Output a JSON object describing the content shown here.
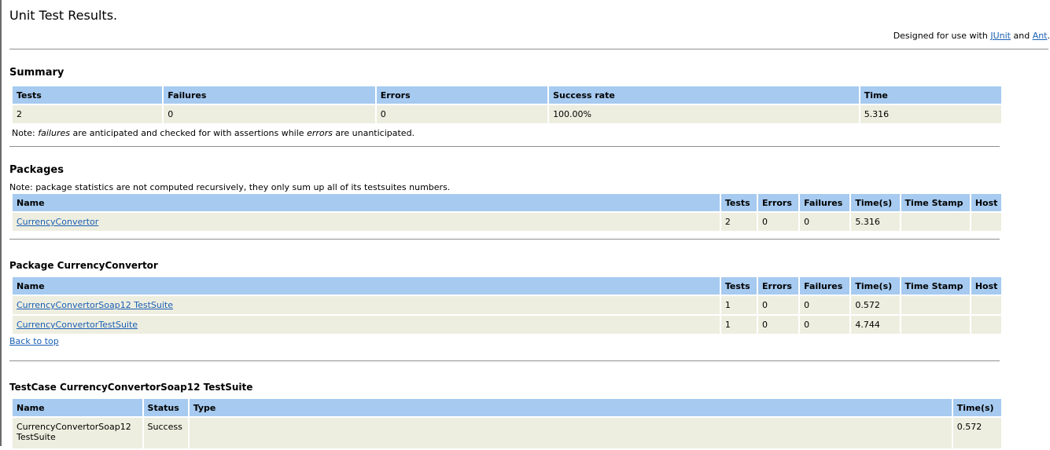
{
  "page": {
    "title": "Unit Test Results.",
    "designed_prefix": "Designed for use with ",
    "designed_link1": "JUnit",
    "designed_and": " and ",
    "designed_link2": "Ant",
    "designed_suffix": "."
  },
  "summary": {
    "heading": "Summary",
    "headers": [
      "Tests",
      "Failures",
      "Errors",
      "Success rate",
      "Time"
    ],
    "row": [
      "2",
      "0",
      "0",
      "100.00%",
      "5.316"
    ],
    "note_prefix": "Note: ",
    "note_em1": "failures",
    "note_mid": " are anticipated and checked for with assertions while ",
    "note_em2": "errors",
    "note_suffix": " are unanticipated."
  },
  "packages": {
    "heading": "Packages",
    "note": "Note: package statistics are not computed recursively, they only sum up all of its testsuites numbers.",
    "headers": [
      "Name",
      "Tests",
      "Errors",
      "Failures",
      "Time(s)",
      "Time Stamp",
      "Host"
    ],
    "row": {
      "name": "CurrencyConvertor",
      "tests": "2",
      "errors": "0",
      "failures": "0",
      "time": "5.316",
      "timestamp": "",
      "host": ""
    }
  },
  "package_detail": {
    "heading": "Package CurrencyConvertor",
    "headers": [
      "Name",
      "Tests",
      "Errors",
      "Failures",
      "Time(s)",
      "Time Stamp",
      "Host"
    ],
    "rows": [
      {
        "name": "CurrencyConvertorSoap12 TestSuite",
        "tests": "1",
        "errors": "0",
        "failures": "0",
        "time": "0.572",
        "timestamp": "",
        "host": ""
      },
      {
        "name": "CurrencyConvertorTestSuite",
        "tests": "1",
        "errors": "0",
        "failures": "0",
        "time": "4.744",
        "timestamp": "",
        "host": ""
      }
    ],
    "back_to_top": "Back to top"
  },
  "testcase": {
    "heading": "TestCase CurrencyConvertorSoap12 TestSuite",
    "headers": [
      "Name",
      "Status",
      "Type",
      "Time(s)"
    ],
    "row": {
      "name_line1": "CurrencyConvertorSoap12",
      "name_line2": "TestSuite",
      "status": "Success",
      "type": "",
      "time": "0.572"
    }
  },
  "colors": {
    "header_bg": "#a6caf0",
    "cell_bg": "#eeeee0",
    "link": "#1a5fb4"
  }
}
